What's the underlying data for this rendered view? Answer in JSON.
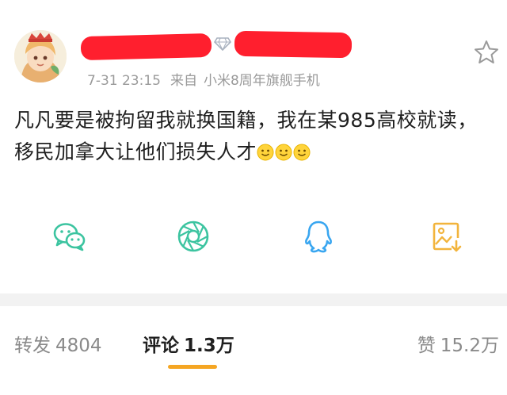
{
  "post": {
    "timestamp": "7-31 23:15",
    "source_prefix": "来自",
    "source_device": "小米8周年旗舰手机",
    "text": "凡凡要是被拘留我就换国籍，我在某985高校就读，移民加拿大让他们损失人才",
    "emoji": [
      "smile-emoji",
      "smile-emoji",
      "smile-emoji"
    ]
  },
  "share": {
    "icons": [
      "wechat-icon",
      "moments-icon",
      "qq-icon",
      "save-image-icon"
    ]
  },
  "tabs": {
    "repost_label": "转发",
    "repost_count": "4804",
    "comment_label": "评论",
    "comment_count": "1.3万",
    "like_label": "赞",
    "like_count": "15.2万"
  },
  "colors": {
    "redaction": "#ff1f2e",
    "share_green": "#3cc4a0",
    "qq_blue": "#39a6f0",
    "save_orange": "#f2b43c",
    "active_underline": "#f5a623"
  }
}
